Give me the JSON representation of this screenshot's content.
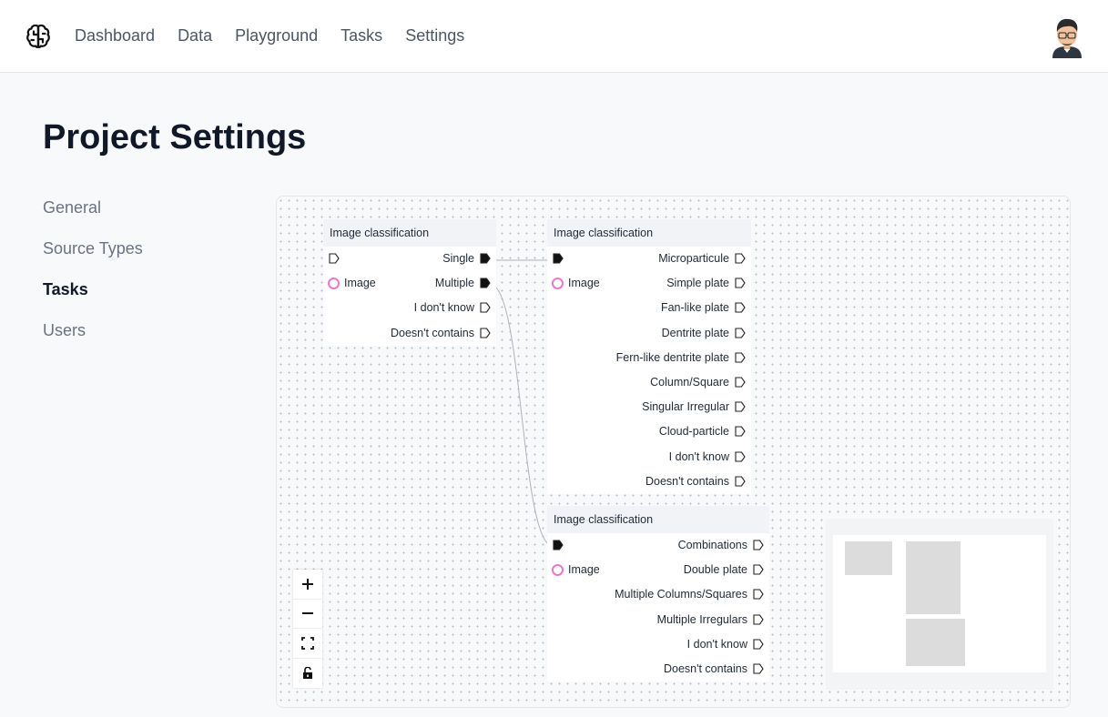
{
  "header": {
    "logo_icon": "brain-icon",
    "nav": [
      {
        "label": "Dashboard"
      },
      {
        "label": "Data"
      },
      {
        "label": "Playground"
      },
      {
        "label": "Tasks"
      },
      {
        "label": "Settings"
      }
    ],
    "avatar_icon": "user-avatar"
  },
  "page": {
    "title": "Project Settings"
  },
  "sidebar": {
    "items": [
      {
        "label": "General",
        "active": false
      },
      {
        "label": "Source Types",
        "active": false
      },
      {
        "label": "Tasks",
        "active": true
      },
      {
        "label": "Users",
        "active": false
      }
    ]
  },
  "flow": {
    "nodes": [
      {
        "title": "Image classification",
        "input_label": "Image",
        "outputs": [
          "Single",
          "Multiple",
          "I don't know",
          "Doesn't contains"
        ]
      },
      {
        "title": "Image classification",
        "input_label": "Image",
        "outputs": [
          "Microparticule",
          "Simple plate",
          "Fan-like plate",
          "Dentrite plate",
          "Fern-like dentrite plate",
          "Column/Square",
          "Singular Irregular",
          "Cloud-particle",
          "I don't know",
          "Doesn't contains"
        ]
      },
      {
        "title": "Image classification",
        "input_label": "Image",
        "outputs": [
          "Combinations",
          "Double plate",
          "Multiple Columns/Squares",
          "Multiple Irregulars",
          "I don't know",
          "Doesn't contains"
        ]
      }
    ],
    "edges": [
      {
        "from": "node-1:Single",
        "to": "node-2:input"
      },
      {
        "from": "node-1:Multiple",
        "to": "node-3:input"
      }
    ],
    "controls": [
      "zoom-in-icon",
      "zoom-out-icon",
      "fit-view-icon",
      "unlock-icon"
    ],
    "colors": {
      "connected_handle": "#111111",
      "image_port": "#e879c9",
      "edge": "#b1b1b7"
    }
  }
}
